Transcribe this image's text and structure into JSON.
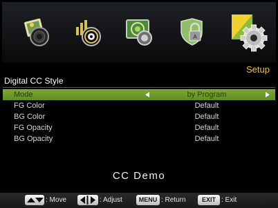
{
  "menu_icons": [
    {
      "name": "picture-icon"
    },
    {
      "name": "sound-icon"
    },
    {
      "name": "channel-icon"
    },
    {
      "name": "lock-icon"
    },
    {
      "name": "setup-gear-icon"
    }
  ],
  "section_label": "Setup",
  "page_title": "Digital CC Style",
  "rows": [
    {
      "label": "Mode",
      "value": "by Program",
      "selected": true
    },
    {
      "label": "FG Color",
      "value": "Default"
    },
    {
      "label": "BG Color",
      "value": "Default"
    },
    {
      "label": "FG Opacity",
      "value": "Default"
    },
    {
      "label": "BG Opacity",
      "value": "Default"
    }
  ],
  "demo_text": "CC Demo",
  "footer": {
    "move_label": ": Move",
    "adjust_label": ": Adjust",
    "menu_key": "MENU",
    "menu_label": ": Return",
    "exit_key": "EXIT",
    "exit_label": ": Exit"
  },
  "colors": {
    "selected_row": "#6f9a2d",
    "setup_label": "#e8c23a"
  }
}
